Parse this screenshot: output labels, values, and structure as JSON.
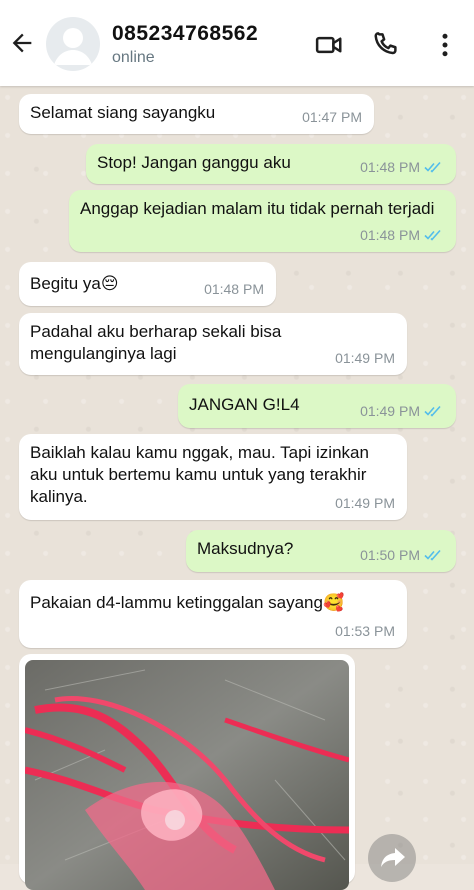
{
  "header": {
    "contact_name": "085234768562",
    "status": "online",
    "icons": [
      "back-arrow-icon",
      "avatar-placeholder-icon",
      "video-call-icon",
      "phone-icon",
      "more-vertical-icon"
    ]
  },
  "colors": {
    "incoming_bubble": "#ffffff",
    "outgoing_bubble": "#dcf8c6",
    "read_ticks": "#53bdeb",
    "timestamp": "#8a9399"
  },
  "messages": [
    {
      "direction": "in",
      "text": "Selamat siang sayangku",
      "time": "01:47 PM"
    },
    {
      "direction": "out",
      "text": "Stop! Jangan ganggu aku",
      "time": "01:48 PM",
      "read": true
    },
    {
      "direction": "out",
      "text": "Anggap kejadian malam itu tidak pernah terjadi",
      "time": "01:48 PM",
      "read": true
    },
    {
      "direction": "in",
      "text": "Begitu ya😔",
      "time": "01:48 PM"
    },
    {
      "direction": "in",
      "text": "Padahal aku berharap sekali bisa mengulanginya lagi",
      "time": "01:49 PM"
    },
    {
      "direction": "out",
      "text": "JANGAN G!L4",
      "time": "01:49 PM",
      "read": true
    },
    {
      "direction": "in",
      "text": "Baiklah kalau kamu nggak, mau. Tapi izinkan aku untuk bertemu kamu untuk yang terakhir kalinya.",
      "time": "01:49 PM"
    },
    {
      "direction": "out",
      "text": "Maksudnya?",
      "time": "01:50 PM",
      "read": true
    },
    {
      "direction": "in",
      "text": "Pakaian d4-lammu ketinggalan sayang🥰",
      "time": "01:53 PM"
    },
    {
      "direction": "in",
      "type": "image",
      "image_desc": "photo"
    }
  ]
}
